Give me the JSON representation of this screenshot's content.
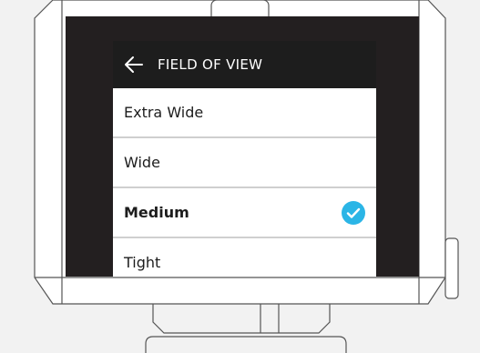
{
  "screen": {
    "title": "FIELD OF VIEW",
    "back_icon": "arrow-left-icon",
    "options": [
      {
        "label": "Extra Wide",
        "selected": false
      },
      {
        "label": "Wide",
        "selected": false
      },
      {
        "label": "Medium",
        "selected": true
      },
      {
        "label": "Tight",
        "selected": false
      }
    ],
    "check_icon": "checkmark-circle-icon"
  },
  "colors": {
    "accent": "#2bb5e6",
    "header_bg": "#1d1d1d",
    "screen_bezel": "#231f20",
    "device_stroke": "#555555",
    "device_fill": "#ffffff",
    "background": "#f2f2f2"
  }
}
